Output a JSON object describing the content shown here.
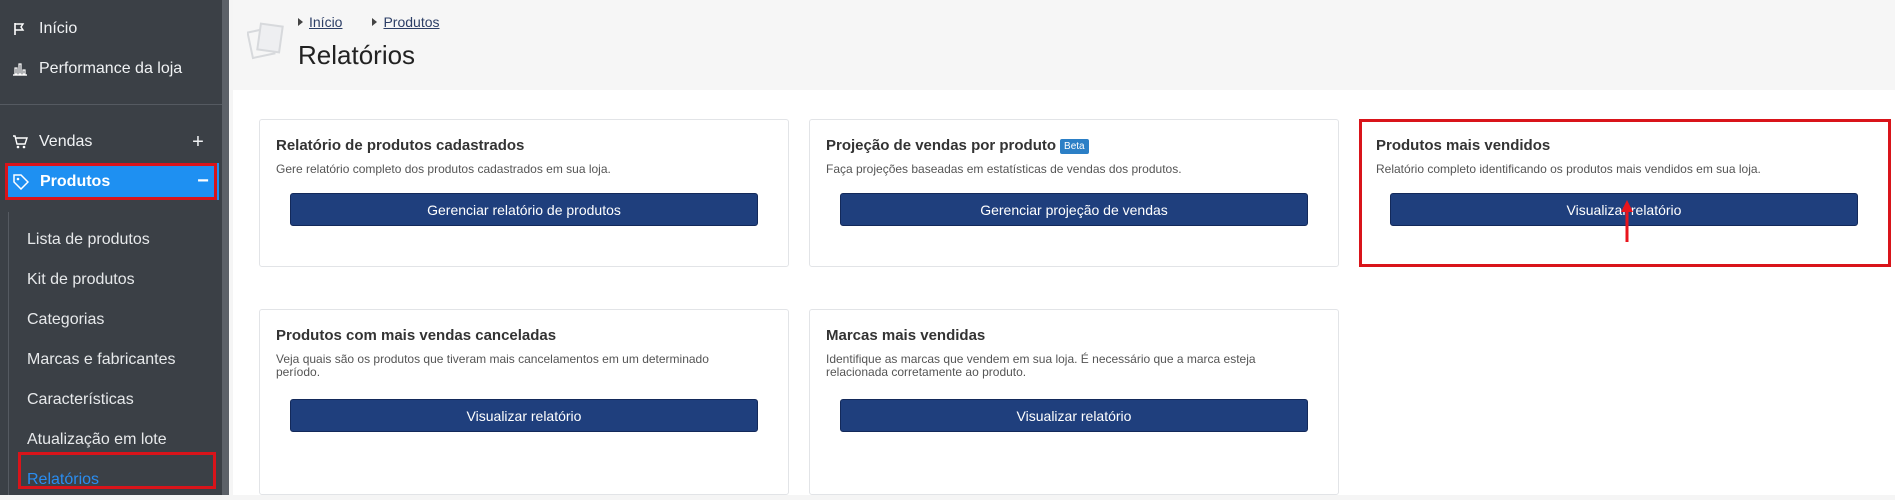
{
  "sidebar": {
    "items": [
      {
        "label": "Início",
        "icon": "flag-icon"
      },
      {
        "label": "Performance da loja",
        "icon": "bar-chart-icon"
      },
      {
        "label": "Vendas",
        "icon": "cart-icon",
        "toggle": "+"
      },
      {
        "label": "Produtos",
        "icon": "tag-icon",
        "toggle": "−"
      }
    ],
    "subitems": [
      "Lista de produtos",
      "Kit de produtos",
      "Categorias",
      "Marcas e fabricantes",
      "Características",
      "Atualização em lote",
      "Relatórios"
    ]
  },
  "header": {
    "breadcrumbs": [
      "Início",
      "Produtos"
    ],
    "title": "Relatórios"
  },
  "cards": [
    {
      "title": "Relatório de produtos cadastrados",
      "desc": "Gere relatório completo dos produtos cadastrados em sua loja.",
      "button": "Gerenciar relatório de produtos"
    },
    {
      "title": "Projeção de vendas por produto",
      "badge": "Beta",
      "desc": "Faça projeções baseadas em estatísticas de vendas dos produtos.",
      "button": "Gerenciar projeção de vendas"
    },
    {
      "title": "Produtos mais vendidos",
      "desc": "Relatório completo identificando os produtos mais vendidos em sua loja.",
      "button": "Visualizar relatório"
    },
    {
      "title": "Produtos com mais vendas canceladas",
      "desc": "Veja quais são os produtos que tiveram mais cancelamentos em um determinado período.",
      "button": "Visualizar relatório"
    },
    {
      "title": "Marcas mais vendidas",
      "desc": "Identifique as marcas que vendem em sua loja. É necessário que a marca esteja relacionada corretamente ao produto.",
      "button": "Visualizar relatório"
    }
  ],
  "colors": {
    "sidebar_bg": "#3b4046",
    "active": "#1e90f2",
    "button": "#1f3f7d",
    "highlight": "#d9141a"
  }
}
